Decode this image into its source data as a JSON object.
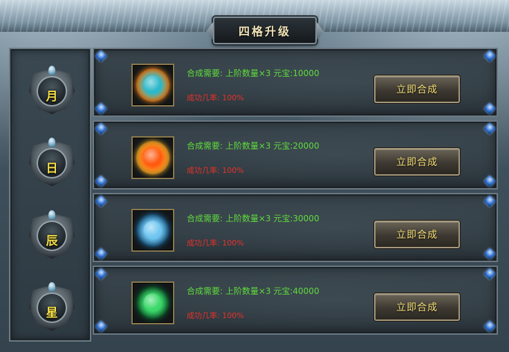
{
  "window": {
    "title": "四格升级"
  },
  "tabs": [
    {
      "label": "月"
    },
    {
      "label": "日"
    },
    {
      "label": "辰"
    },
    {
      "label": "星"
    }
  ],
  "rows": [
    {
      "requirement": "合成需要: 上阶数量×3 元宝:10000",
      "success_rate": "成功几率: 100%",
      "button_label": "立即合成",
      "orb_colors": [
        "#2bb8c9",
        "#ff8a1a"
      ]
    },
    {
      "requirement": "合成需要: 上阶数量×3 元宝:20000",
      "success_rate": "成功几率: 100%",
      "button_label": "立即合成",
      "orb_colors": [
        "#ff5a10",
        "#ffb52a"
      ]
    },
    {
      "requirement": "合成需要: 上阶数量×3 元宝:30000",
      "success_rate": "成功几率: 100%",
      "button_label": "立即合成",
      "orb_colors": [
        "#6fc6f0",
        "#1f5e8a"
      ]
    },
    {
      "requirement": "合成需要: 上阶数量×3 元宝:40000",
      "success_rate": "成功几率: 100%",
      "button_label": "立即合成",
      "orb_colors": [
        "#3bd86a",
        "#0f5e2e"
      ]
    }
  ],
  "colors": {
    "requirement_text": "#5fdc3c",
    "rate_text": "#e6322a",
    "button_text": "#f7e27a",
    "tab_glyph": "#f6e04a"
  }
}
